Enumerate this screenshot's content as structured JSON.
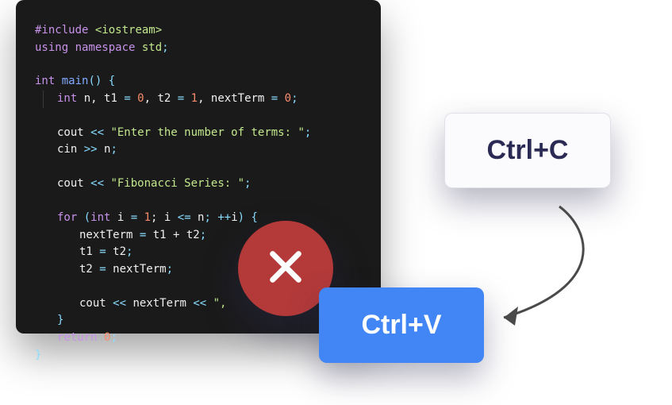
{
  "code": {
    "l1_include": "#include",
    "l1_iostream": " <iostream>",
    "l2_using": "using",
    "l2_namespace": " namespace",
    "l2_std": " std",
    "l2_semi": ";",
    "l3_int": "int",
    "l3_main": " main",
    "l3_parens": "()",
    "l3_brace": " {",
    "l4_int": "int",
    "l4_vars": " n, t1 ",
    "l4_eq1": "= ",
    "l4_zero1": "0",
    "l4_c1": ", t2 ",
    "l4_eq2": "= ",
    "l4_one": "1",
    "l4_c2": ", nextTerm ",
    "l4_eq3": "= ",
    "l4_zero2": "0",
    "l4_semi": ";",
    "l5_cout": "cout ",
    "l5_op": "<< ",
    "l5_str": "\"Enter the number of terms: \"",
    "l5_semi": ";",
    "l6_cin": "cin ",
    "l6_op": ">> ",
    "l6_n": "n",
    "l6_semi": ";",
    "l7_cout": "cout ",
    "l7_op": "<< ",
    "l7_str": "\"Fibonacci Series: \"",
    "l7_semi": ";",
    "l8_for": "for",
    "l8_open": " (",
    "l8_int": "int",
    "l8_i": " i ",
    "l8_eq": "= ",
    "l8_one": "1",
    "l8_sc1": "; i ",
    "l8_le": "<=",
    "l8_n": " n",
    "l8_sc2": "; ",
    "l8_inc": "++",
    "l8_i2": "i",
    "l8_close": ") {",
    "l9_nt": "nextTerm ",
    "l9_eq": "= ",
    "l9_rhs": "t1 + t2",
    "l9_semi": ";",
    "l10_t1": "t1 ",
    "l10_eq": "= ",
    "l10_t2": "t2",
    "l10_semi": ";",
    "l11_t2": "t2 ",
    "l11_eq": "= ",
    "l11_nt": "nextTerm",
    "l11_semi": ";",
    "l12_cout": "cout ",
    "l12_op1": "<< ",
    "l12_nt": "nextTerm ",
    "l12_op2": "<< ",
    "l12_str": "\",",
    "l13_brace": "}",
    "l14_return": "return",
    "l14_sp": " ",
    "l14_zero": "0",
    "l14_semi": ";",
    "l15_brace": "}"
  },
  "labels": {
    "copy": "Ctrl+C",
    "paste": "Ctrl+V"
  },
  "colors": {
    "editor_bg": "#1a1a1a",
    "badge_red": "#b43a3a",
    "card_blue": "#4285f4"
  }
}
